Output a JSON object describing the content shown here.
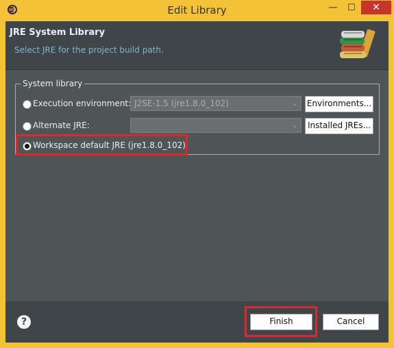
{
  "window": {
    "title": "Edit Library",
    "min_glyph": "—",
    "max_glyph": "☐",
    "close_glyph": "✕",
    "app_icon": "eclipse-icon"
  },
  "header": {
    "title": "JRE System Library",
    "subtitle": "Select JRE for the project build path."
  },
  "group": {
    "title": "System library",
    "options": [
      {
        "label": "Execution environment:",
        "selected": false,
        "combo_value": "J2SE-1.5 (jre1.8.0_102)",
        "button": "Environments..."
      },
      {
        "label": "Alternate JRE:",
        "selected": false,
        "combo_value": "",
        "button": "Installed JREs..."
      },
      {
        "label": "Workspace default JRE (jre1.8.0_102)",
        "selected": true
      }
    ]
  },
  "footer": {
    "help_glyph": "?",
    "finish": "Finish",
    "cancel": "Cancel"
  },
  "colors": {
    "title_bar": "#f3c237",
    "close_button": "#c7342b",
    "highlight": "#e0262d",
    "panel_dark": "#3f4548",
    "panel": "#4f5457"
  }
}
